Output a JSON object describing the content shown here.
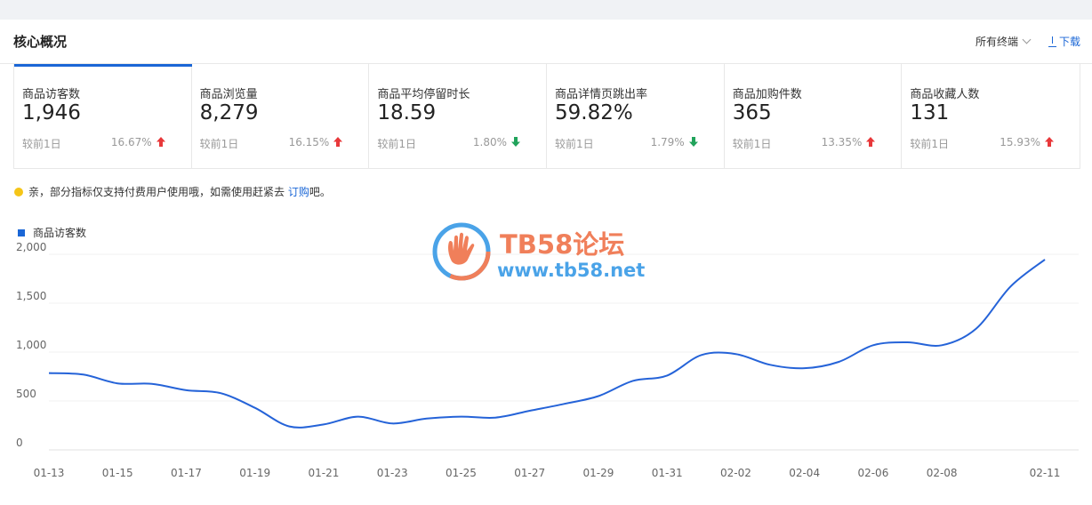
{
  "header": {
    "title": "核心概况",
    "terminal_select": "所有终端",
    "download_label": "下载"
  },
  "metrics": [
    {
      "label": "商品访客数",
      "value": "1,946",
      "compare": "较前1日",
      "change": "16.67%",
      "direction": "up"
    },
    {
      "label": "商品浏览量",
      "value": "8,279",
      "compare": "较前1日",
      "change": "16.15%",
      "direction": "up"
    },
    {
      "label": "商品平均停留时长",
      "value": "18.59",
      "compare": "较前1日",
      "change": "1.80%",
      "direction": "down"
    },
    {
      "label": "商品详情页跳出率",
      "value": "59.82%",
      "compare": "较前1日",
      "change": "1.79%",
      "direction": "down"
    },
    {
      "label": "商品加购件数",
      "value": "365",
      "compare": "较前1日",
      "change": "13.35%",
      "direction": "up"
    },
    {
      "label": "商品收藏人数",
      "value": "131",
      "compare": "较前1日",
      "change": "15.93%",
      "direction": "up"
    }
  ],
  "colors": {
    "accent": "#1a66d6",
    "up": "#e8383a",
    "down": "#21a35b",
    "line": "#2563d8"
  },
  "notice": {
    "text_before": "亲，部分指标仅支持付费用户使用哦，如需使用赶紧去 ",
    "link": "订购",
    "text_after": "吧。"
  },
  "watermark": {
    "title": "TB58论坛",
    "url": "www.tb58.net"
  },
  "chart_data": {
    "type": "line",
    "series": [
      {
        "name": "商品访客数",
        "x": [
          "01-13",
          "01-14",
          "01-15",
          "01-16",
          "01-17",
          "01-18",
          "01-19",
          "01-20",
          "01-21",
          "01-22",
          "01-23",
          "01-24",
          "01-25",
          "01-26",
          "01-27",
          "01-28",
          "01-29",
          "01-30",
          "01-31",
          "02-01",
          "02-02",
          "02-03",
          "02-04",
          "02-05",
          "02-06",
          "02-07",
          "02-08",
          "02-09",
          "02-10",
          "02-11"
        ],
        "values": [
          785,
          770,
          680,
          675,
          610,
          580,
          430,
          240,
          260,
          340,
          270,
          320,
          340,
          330,
          400,
          470,
          550,
          705,
          760,
          970,
          980,
          870,
          835,
          900,
          1070,
          1100,
          1070,
          1240,
          1670,
          1946
        ]
      }
    ],
    "x_tick_labels": [
      "01-13",
      "01-15",
      "01-17",
      "01-19",
      "01-21",
      "01-23",
      "01-25",
      "01-27",
      "01-29",
      "01-31",
      "02-02",
      "02-04",
      "02-06",
      "02-08",
      "02-11"
    ],
    "y_ticks": [
      "0",
      "500",
      "1,000",
      "1,500",
      "2,000"
    ],
    "ylim": [
      0,
      2000
    ],
    "grid": true,
    "legend": "top-left"
  }
}
